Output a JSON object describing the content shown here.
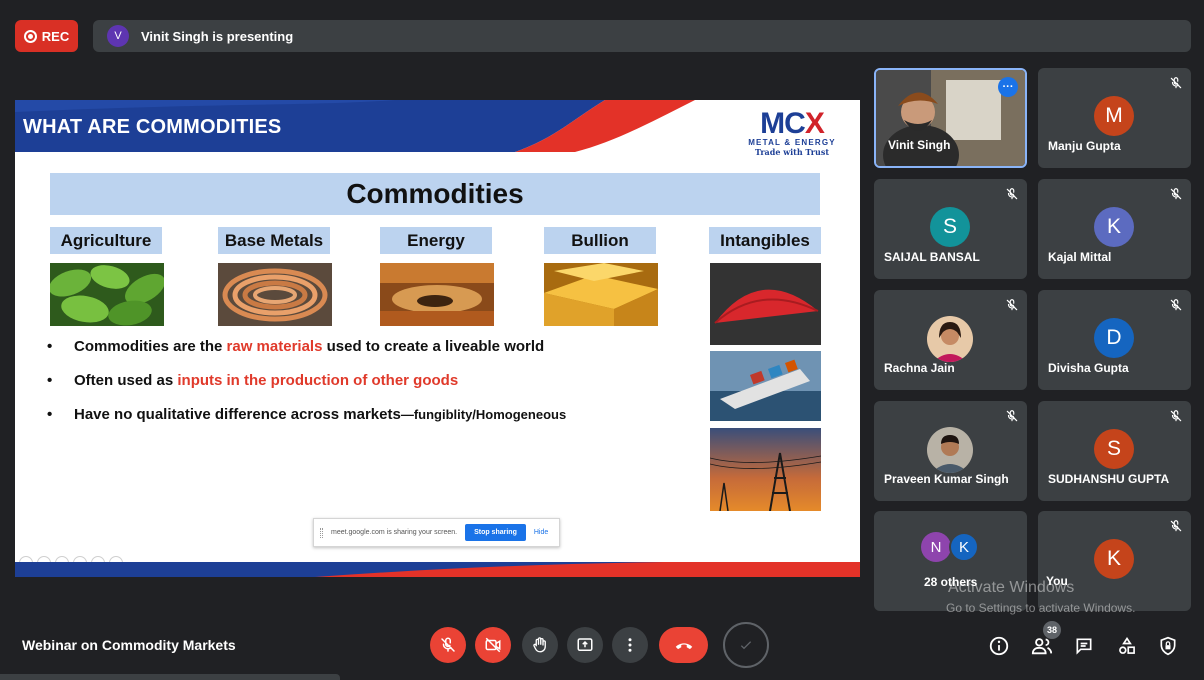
{
  "top_bar": {
    "rec_label": "REC",
    "presenter_initial": "V",
    "presenting_text": "Vinit Singh is presenting"
  },
  "slide": {
    "title": "WHAT ARE COMMODITIES",
    "logo_main": "MCX",
    "logo_sub": "METAL & ENERGY",
    "logo_tagline": "Trade with Trust",
    "banner": "Commodities",
    "categories": [
      "Agriculture",
      "Base Metals",
      "Energy",
      "Bullion",
      "Intangibles"
    ],
    "bullets": [
      {
        "before": "Commodities are the ",
        "highlight": "raw materials",
        "after": " used to create a liveable world"
      },
      {
        "before": "Often used as ",
        "highlight": "inputs in the production of other goods",
        "after": ""
      },
      {
        "before": "Have no qualitative difference across markets",
        "highlight": "",
        "after": "—fungiblity/Homogeneous"
      }
    ],
    "share_notice": {
      "text": "meet.google.com is sharing your screen.",
      "stop": "Stop sharing",
      "hide": "Hide"
    }
  },
  "participants": [
    {
      "name": "Vinit Singh",
      "initial": "",
      "color": "",
      "video": true
    },
    {
      "name": "Manju Gupta",
      "initial": "M",
      "color": "#c5441b"
    },
    {
      "name": "SAIJAL BANSAL",
      "initial": "S",
      "color": "#12939a"
    },
    {
      "name": "Kajal Mittal",
      "initial": "K",
      "color": "#5c6bc0"
    },
    {
      "name": "Rachna Jain",
      "initial": "",
      "color": "",
      "photo": true
    },
    {
      "name": "Divisha Gupta",
      "initial": "D",
      "color": "#1565c0"
    },
    {
      "name": "Praveen Kumar Singh",
      "initial": "",
      "color": "",
      "photo": true
    },
    {
      "name": "SUDHANSHU GUPTA",
      "initial": "S",
      "color": "#c5441b"
    },
    {
      "name": "28 others",
      "initials": [
        "N",
        "K"
      ],
      "colors": [
        "#8e44ad",
        "#1565c0"
      ]
    },
    {
      "name": "You",
      "initial": "K",
      "color": "#c5441b"
    }
  ],
  "watermark": {
    "line1": "Activate Windows",
    "line2": "Go to Settings to activate Windows."
  },
  "bottom_bar": {
    "meeting_title": "Webinar on Commodity Markets",
    "people_count": "38"
  },
  "icons": {
    "mic_off": "mic-off-icon",
    "camera_off": "camera-off-icon",
    "raise_hand": "hand-icon",
    "present": "present-icon",
    "more": "more-vert-icon",
    "end_call": "end-call-icon",
    "info": "info-icon",
    "people": "people-icon",
    "chat": "chat-icon",
    "activities": "activities-icon",
    "host_controls": "shield-icon"
  },
  "colors": {
    "background": "#202124",
    "tile": "#3c4043",
    "rec_red": "#d93025",
    "end_call_red": "#ea4335",
    "slide_blue": "#1d3f96",
    "slide_red": "#e33228",
    "banner_blue": "#bcd3ef",
    "highlight_red": "#e03a2b"
  }
}
